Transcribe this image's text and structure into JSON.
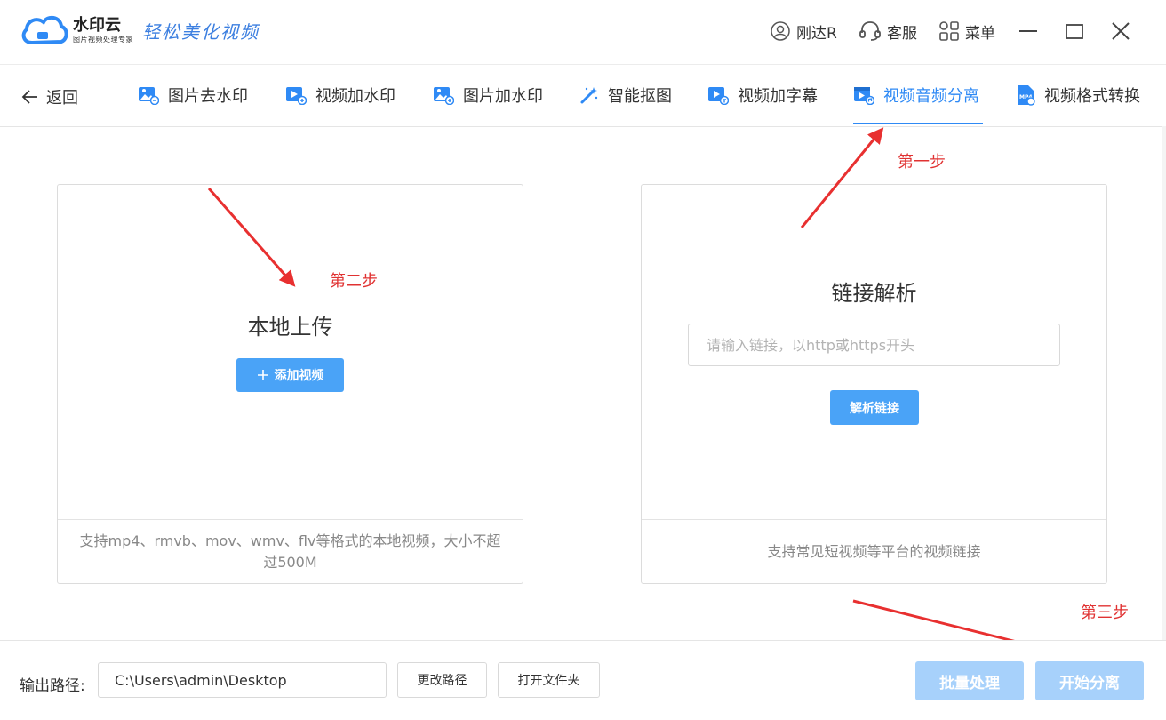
{
  "app": {
    "logo_name": "水印云",
    "logo_sub": "图片视频处理专家",
    "slogan": "轻松美化视频",
    "user": "刚达R",
    "service": "客服",
    "menu": "菜单"
  },
  "nav": {
    "back": "返回",
    "tabs": [
      {
        "label": "图片去水印",
        "icon": "image-remove-icon"
      },
      {
        "label": "视频加水印",
        "icon": "video-watermark-icon"
      },
      {
        "label": "图片加水印",
        "icon": "image-watermark-icon"
      },
      {
        "label": "智能抠图",
        "icon": "magic-wand-icon"
      },
      {
        "label": "视频加字幕",
        "icon": "video-subtitle-icon"
      },
      {
        "label": "视频音频分离",
        "icon": "video-audio-split-icon"
      },
      {
        "label": "视频格式转换",
        "icon": "mp4-file-icon"
      }
    ],
    "active_tab": "视频音频分离"
  },
  "local_upload": {
    "title": "本地上传",
    "button": "添加视频",
    "note": "支持mp4、rmvb、mov、wmv、flv等格式的本地视频，大小不超过500M"
  },
  "link_parse": {
    "title": "链接解析",
    "placeholder": "请输入链接，以http或https开头",
    "button": "解析链接",
    "note": "支持常见短视频等平台的视频链接"
  },
  "annotations": {
    "step1": "第一步",
    "step2": "第二步",
    "step3": "第三步"
  },
  "bottom": {
    "output_label": "输出路径:",
    "output_path": "C:\\Users\\admin\\Desktop",
    "change_path": "更改路径",
    "open_folder": "打开文件夹",
    "batch": "批量处理",
    "start": "开始分离"
  },
  "colors": {
    "accent": "#2f8af5",
    "button": "#4aa3f7",
    "button_disabled": "#a7d1fb",
    "annotation": "#e03232"
  }
}
